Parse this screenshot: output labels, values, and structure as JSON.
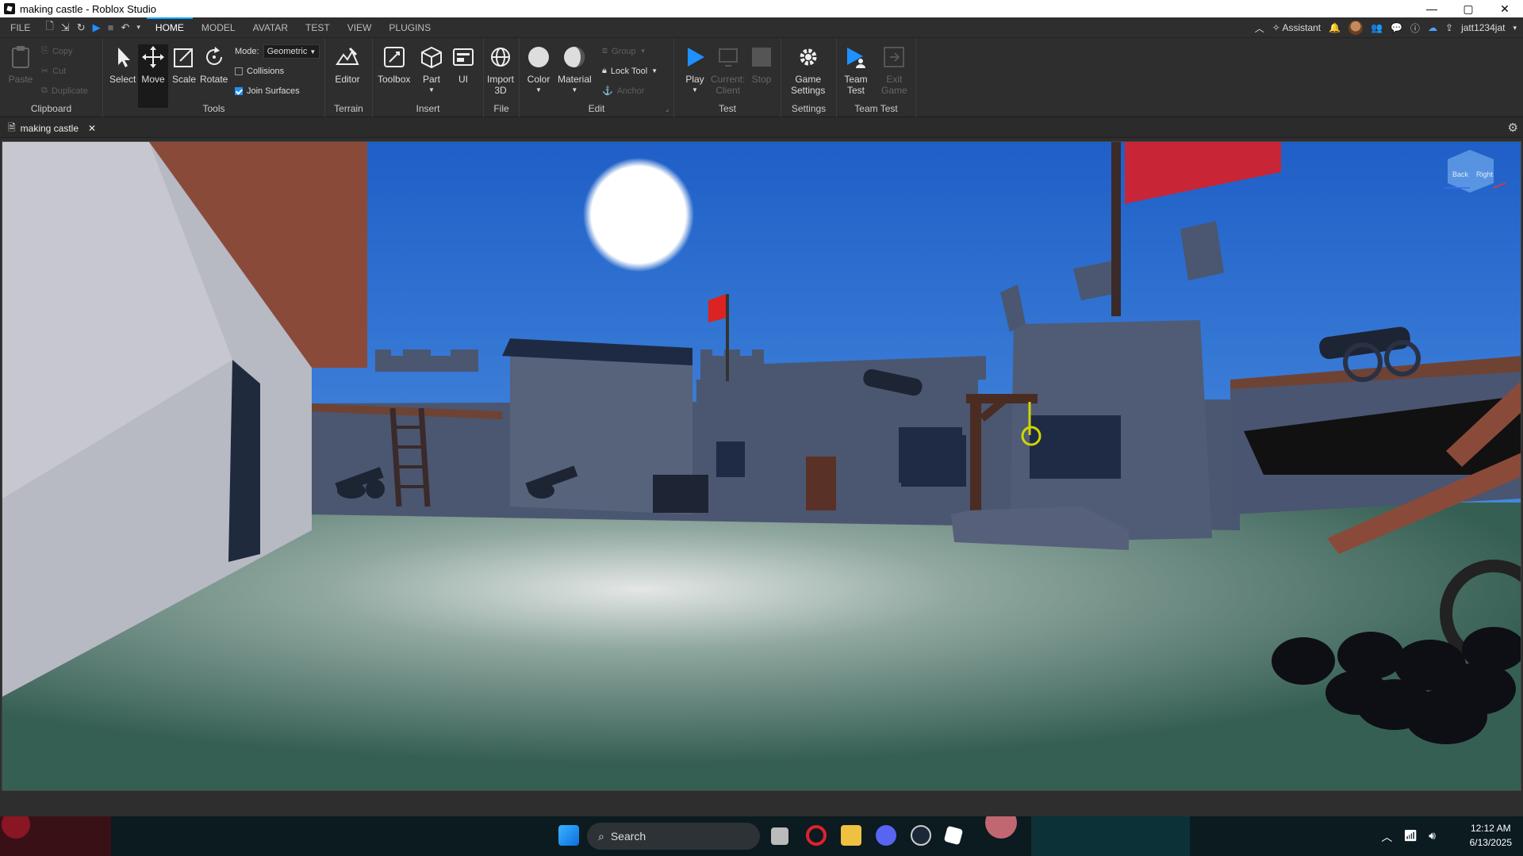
{
  "window": {
    "title": "making castle - Roblox Studio",
    "minimize": "—",
    "maximize": "▢",
    "close": "✕"
  },
  "menu": {
    "file": "FILE",
    "tabs": [
      "HOME",
      "MODEL",
      "AVATAR",
      "TEST",
      "VIEW",
      "PLUGINS"
    ],
    "active_tab": "HOME",
    "assistant": "Assistant",
    "username": "jatt1234jat"
  },
  "ribbon": {
    "clipboard": {
      "label": "Clipboard",
      "paste": "Paste",
      "copy": "Copy",
      "cut": "Cut",
      "duplicate": "Duplicate"
    },
    "tools": {
      "label": "Tools",
      "select": "Select",
      "move": "Move",
      "scale": "Scale",
      "rotate": "Rotate",
      "mode_label": "Mode:",
      "mode_value": "Geometric",
      "collisions": "Collisions",
      "join_surfaces": "Join Surfaces"
    },
    "terrain": {
      "label": "Terrain",
      "editor": "Editor"
    },
    "insert": {
      "label": "Insert",
      "toolbox": "Toolbox",
      "part": "Part",
      "ui": "UI"
    },
    "file": {
      "label": "File",
      "import3d_line1": "Import",
      "import3d_line2": "3D"
    },
    "edit": {
      "label": "Edit",
      "color": "Color",
      "material": "Material",
      "group": "Group",
      "lock_tool": "Lock Tool",
      "anchor": "Anchor"
    },
    "test": {
      "label": "Test",
      "play": "Play",
      "current_client_line1": "Current:",
      "current_client_line2": "Client",
      "stop": "Stop"
    },
    "settings": {
      "label": "Settings",
      "game_settings_line1": "Game",
      "game_settings_line2": "Settings"
    },
    "team_test": {
      "label": "Team Test",
      "team_test_line1": "Team",
      "team_test_line2": "Test",
      "exit_game_line1": "Exit",
      "exit_game_line2": "Game"
    }
  },
  "document": {
    "tab_label": "making castle"
  },
  "viewcube": {
    "left": "Back",
    "right": "Right"
  },
  "taskbar": {
    "search": "Search",
    "time": "12:12 AM",
    "date": "6/13/2025"
  },
  "colors": {
    "accent": "#00a2ff",
    "play": "#1e90ff",
    "sky_top": "#1f5fc7",
    "ground": "#3f6f60"
  }
}
